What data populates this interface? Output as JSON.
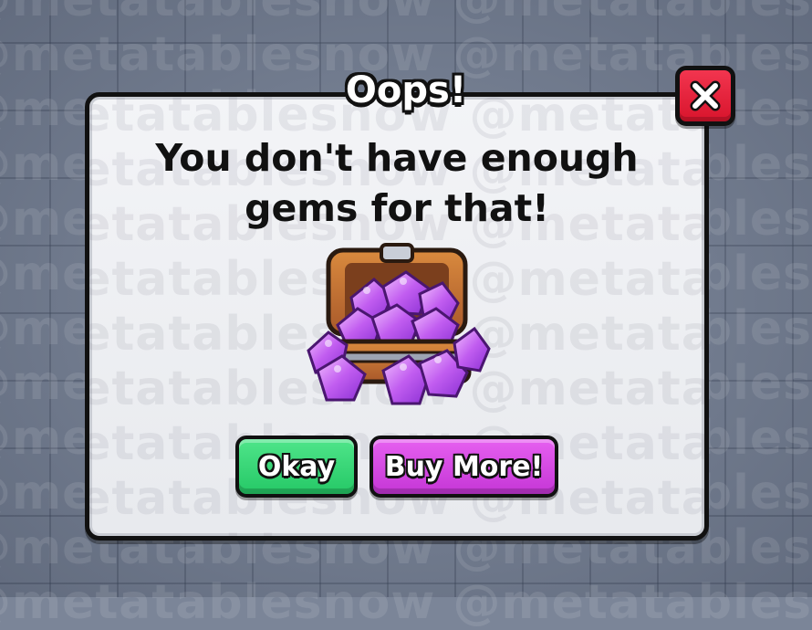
{
  "watermark": "@metatablesnow @metatablesnow @metatablesnow",
  "dialog": {
    "title": "Oops!",
    "message_line1": "You don't have enough",
    "message_line2": "gems for that!",
    "image": "gem-chest-icon",
    "close_icon": "close-icon",
    "buttons": {
      "okay_label": "Okay",
      "buy_more_label": "Buy More!"
    }
  },
  "colors": {
    "close_button": "#e3203b",
    "okay_button": "#37d675",
    "buy_more_button": "#d548e3",
    "dialog_background": "#eef0f3"
  }
}
